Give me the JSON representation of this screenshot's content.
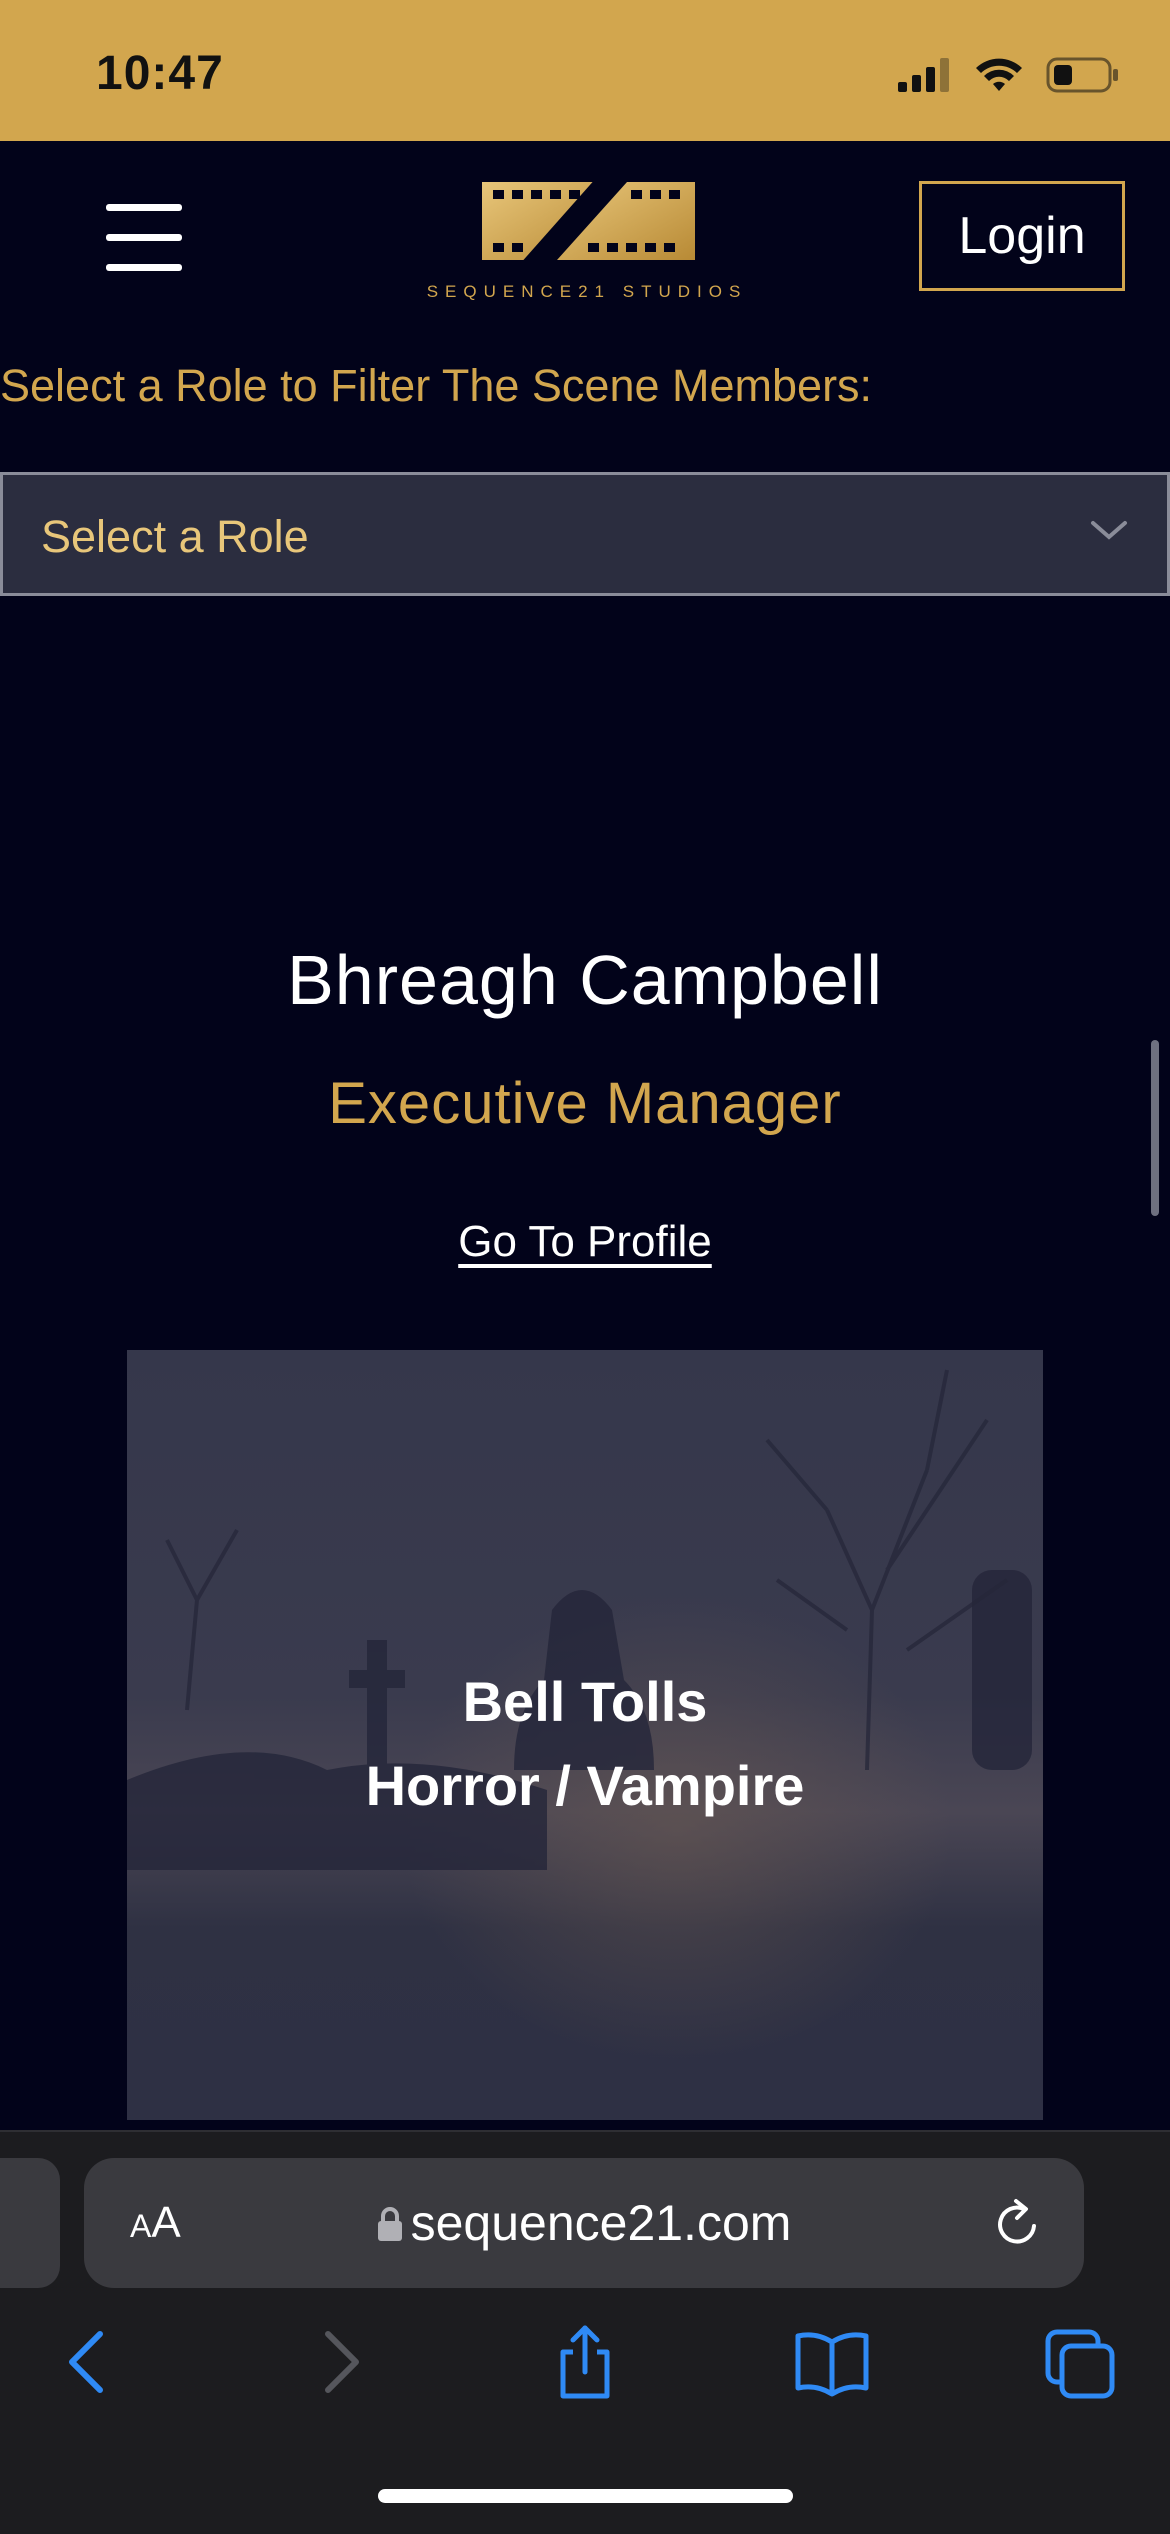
{
  "status_bar": {
    "time": "10:47",
    "signal_icon": "cellular-signal-icon",
    "wifi_icon": "wifi-icon",
    "battery_icon": "battery-low-icon"
  },
  "header": {
    "menu_icon": "hamburger-menu-icon",
    "logo_text": "SEQUENCE21 STUDIOS",
    "login_label": "Login"
  },
  "filter": {
    "label": "Select a Role to Filter The Scene Members:",
    "selected": "Select a Role",
    "chevron_icon": "chevron-down-icon"
  },
  "member": {
    "name": "Bhreagh Campbell",
    "role": "Executive Manager",
    "profile_link": "Go To Profile",
    "scene": {
      "title": "Bell Tolls",
      "genre": "Horror / Vampire"
    }
  },
  "browser": {
    "text_size_label": "AA",
    "url": "sequence21.com",
    "lock_icon": "lock-icon",
    "reload_icon": "reload-icon",
    "toolbar": [
      "back-icon",
      "forward-icon",
      "share-icon",
      "bookmarks-icon",
      "tabs-icon"
    ]
  },
  "colors": {
    "accent": "#d2a64e",
    "page_background": "#02031a",
    "ios_blue": "#2f8af5"
  }
}
